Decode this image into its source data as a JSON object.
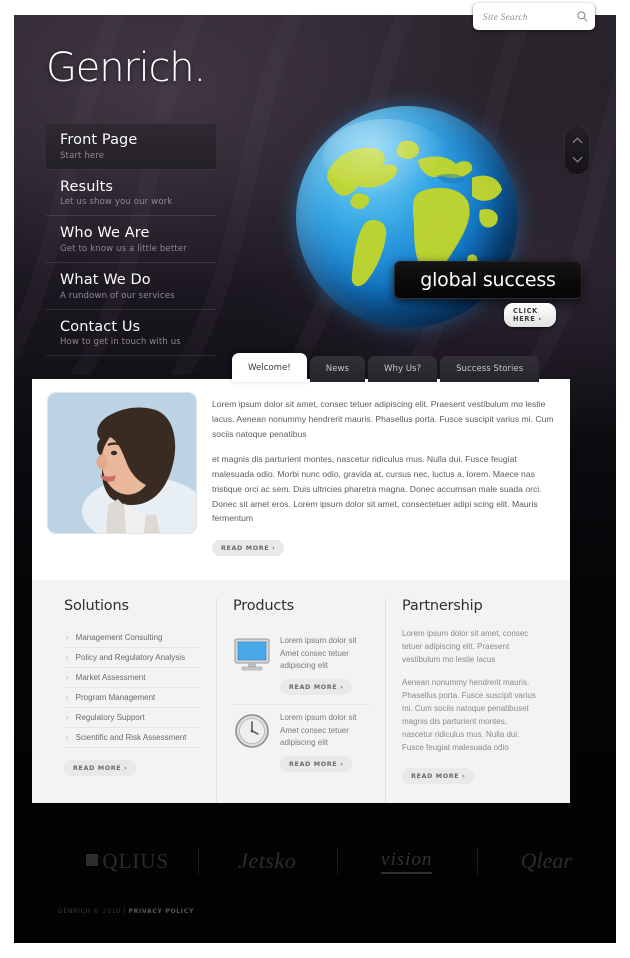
{
  "search": {
    "placeholder": "Site Search",
    "value": "",
    "icon": "search-icon"
  },
  "brand": {
    "logo": "Genrich."
  },
  "nav": {
    "items": [
      {
        "title": "Front Page",
        "sub": "Start here",
        "active": true
      },
      {
        "title": "Results",
        "sub": "Let us show you our work",
        "active": false
      },
      {
        "title": "Who We Are",
        "sub": "Get to know us a little better",
        "active": false
      },
      {
        "title": "What We Do",
        "sub": "A rundown of our services",
        "active": false
      },
      {
        "title": "Contact Us",
        "sub": "How to get in touch with us",
        "active": false
      }
    ]
  },
  "hero": {
    "banner_text": "global success",
    "cta_label": "CLICK HERE  ›",
    "scroll_up_icon": "chevron-up-icon",
    "scroll_down_icon": "chevron-down-icon",
    "globe_colors": {
      "ocean": "#1277c9",
      "land": "#c8d92b",
      "glow": "#2f9fe0"
    }
  },
  "tabs": [
    {
      "label": "Welcome!",
      "active": true
    },
    {
      "label": "News",
      "active": false
    },
    {
      "label": "Why Us?",
      "active": false
    },
    {
      "label": "Success Stories",
      "active": false
    }
  ],
  "welcome": {
    "portrait_alt": "man-portrait",
    "paragraph1": "Lorem ipsum dolor sit amet, consec tetuer adipiscing elit. Praesent vestibulum mo lestie lacus. Aenean nonummy hendrerit mauris. Phasellus porta. Fusce suscipit varius mi. Cum sociis natoque penatibus",
    "paragraph2": "et magnis dis parturient montes, nascetur ridiculus mus. Nulla dui. Fusce feugiat malesuada odio. Morbi nunc odio, gravida at, cursus nec, luctus a, lorem. Maece nas tristique orci ac sem. Duis ultricies pharetra magna. Donec accumsan male suada orci. Donec sit amet eros. Lorem ipsum dolor sit amet, consectetuer adipi scing elit. Mauris fermentum",
    "read_more": "READ MORE  ›"
  },
  "solutions": {
    "heading": "Solutions",
    "items": [
      "Management Consulting",
      "Policy and Regulatory Analysis",
      "Market Assessment",
      "Program Management",
      "Regulatory Support",
      "Scientific and Risk Assessment"
    ],
    "read_more": "READ MORE  ›"
  },
  "products": {
    "heading": "Products",
    "items": [
      {
        "icon": "monitor-icon",
        "text": "Lorem ipsum dolor sit Amet consec tetuer adipiscing elit",
        "read_more": "READ MORE  ›"
      },
      {
        "icon": "clock-icon",
        "text": "Lorem ipsum dolor sit Amet consec tetuer adipiscing elit",
        "read_more": "READ MORE  ›"
      }
    ]
  },
  "partnership": {
    "heading": "Partnership",
    "paragraph1": "Lorem ipsum dolor sit amet, consec tetuer adipiscing elit. Praesent vestibulum mo lestie lacus",
    "paragraph2": "Aenean nonummy hendrerit mauris. Phasellus porta. Fusce suscipit varius mi. Cum sociis natoque penatibuset magnis dis parturient montes, nascetur ridiculus mus. Nulla dui. Fusce feugiat malesuada odio",
    "read_more": "READ MORE  ›"
  },
  "partners": [
    {
      "name": "QLIUS",
      "mark": "■"
    },
    {
      "name": "Jetsko",
      "mark": ""
    },
    {
      "name": "vision",
      "mark": ""
    },
    {
      "name": "Qlear",
      "mark": ""
    }
  ],
  "footer": {
    "copyright": "GENRICH © 2010 | ",
    "privacy": "PRIVACY POLICY"
  }
}
